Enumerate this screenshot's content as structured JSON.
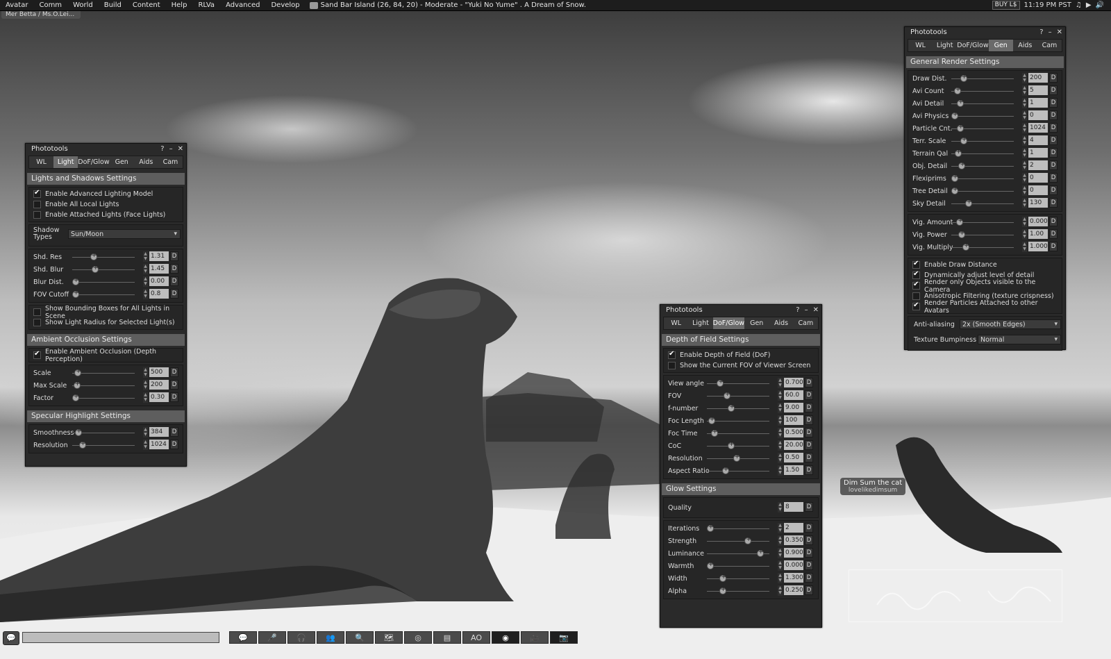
{
  "menubar": {
    "items": [
      "Avatar",
      "Comm",
      "World",
      "Build",
      "Content",
      "Help",
      "RLVa",
      "Advanced",
      "Develop"
    ],
    "location": "Sand Bar Island (26, 84, 20) - Moderate - \"Yuki No Yume\" . A Dream of Snow.",
    "buy": "BUY L$",
    "time": "11:19 PM PST",
    "nav_tag": "Mer Betta / Ms.O.Lei..."
  },
  "nametag": {
    "name": "Dim Sum the cat",
    "username": "lovelikedimsum"
  },
  "panel_light": {
    "title": "Phototools",
    "tabs": [
      "WL",
      "Light",
      "DoF/Glow",
      "Gen",
      "Aids",
      "Cam"
    ],
    "active_tab": "Light",
    "section1": "Lights and Shadows Settings",
    "checks1": [
      {
        "label": "Enable Advanced Lighting Model",
        "checked": true
      },
      {
        "label": "Enable All Local Lights",
        "checked": false
      },
      {
        "label": "Enable Attached Lights (Face Lights)",
        "checked": false
      }
    ],
    "shadow_label": "Shadow Types",
    "shadow_value": "Sun/Moon",
    "sliders1": [
      {
        "label": "Shd. Res",
        "value": "1.31",
        "pos": 0.32
      },
      {
        "label": "Shd. Blur",
        "value": "1.45",
        "pos": 0.35
      },
      {
        "label": "Blur Dist.",
        "value": "0.00",
        "pos": 0.0
      },
      {
        "label": "FOV Cutoff",
        "value": "0.8",
        "pos": 0.0
      }
    ],
    "checks2": [
      {
        "label": "Show Bounding Boxes for All Lights in Scene",
        "checked": false
      },
      {
        "label": "Show Light Radius for Selected Light(s)",
        "checked": false
      }
    ],
    "section2": "Ambient Occlusion Settings",
    "checks3": [
      {
        "label": "Enable Ambient Occlusion (Depth Perception)",
        "checked": true
      }
    ],
    "sliders2": [
      {
        "label": "Scale",
        "value": "500",
        "pos": 0.04
      },
      {
        "label": "Max Scale",
        "value": "200",
        "pos": 0.02
      },
      {
        "label": "Factor",
        "value": "0.30",
        "pos": 0.0
      }
    ],
    "section3": "Specular Highlight Settings",
    "sliders3": [
      {
        "label": "Smoothness",
        "value": "384",
        "pos": 0.05
      },
      {
        "label": "Resolution",
        "value": "1024",
        "pos": 0.12
      }
    ],
    "d": "D"
  },
  "panel_dof": {
    "title": "Phototools",
    "tabs": [
      "WL",
      "Light",
      "DoF/Glow",
      "Gen",
      "Aids",
      "Cam"
    ],
    "active_tab": "DoF/Glow",
    "section1": "Depth of Field Settings",
    "checks1": [
      {
        "label": "Enable Depth of Field (DoF)",
        "checked": true
      },
      {
        "label": "Show the Current FOV of Viewer Screen",
        "checked": false
      }
    ],
    "sliders1": [
      {
        "label": "View angle",
        "value": "0.700",
        "pos": 0.18
      },
      {
        "label": "FOV",
        "value": "60.0",
        "pos": 0.3
      },
      {
        "label": "f-number",
        "value": "9.00",
        "pos": 0.38
      },
      {
        "label": "Foc Length",
        "value": "100",
        "pos": 0.02
      },
      {
        "label": "Foc Time",
        "value": "0.500",
        "pos": 0.07
      },
      {
        "label": "CoC",
        "value": "20.00",
        "pos": 0.37
      },
      {
        "label": "Resolution",
        "value": "0.50",
        "pos": 0.47
      },
      {
        "label": "Aspect Ratio",
        "value": "1.50",
        "pos": 0.27
      }
    ],
    "section2": "Glow Settings",
    "quality_label": "Quality",
    "quality_value": "8",
    "sliders2": [
      {
        "label": "Iterations",
        "value": "2",
        "pos": 0.0
      },
      {
        "label": "Strength",
        "value": "0.350",
        "pos": 0.68
      },
      {
        "label": "Luminance",
        "value": "0.900",
        "pos": 0.9
      },
      {
        "label": "Warmth",
        "value": "0.000",
        "pos": 0.0
      },
      {
        "label": "Width",
        "value": "1.300",
        "pos": 0.23
      },
      {
        "label": "Alpha",
        "value": "0.250",
        "pos": 0.22
      }
    ],
    "d": "D"
  },
  "panel_gen": {
    "title": "Phototools",
    "tabs": [
      "WL",
      "Light",
      "DoF/Glow",
      "Gen",
      "Aids",
      "Cam"
    ],
    "active_tab": "Gen",
    "section1": "General Render Settings",
    "sliders1": [
      {
        "label": "Draw Dist.",
        "value": "200",
        "pos": 0.16
      },
      {
        "label": "Avi Count",
        "value": "5",
        "pos": 0.05
      },
      {
        "label": "Avi Detail",
        "value": "1",
        "pos": 0.1
      },
      {
        "label": "Avi Physics",
        "value": "0",
        "pos": 0.0
      },
      {
        "label": "Particle Cnt.",
        "value": "1024",
        "pos": 0.1
      },
      {
        "label": "Terr. Scale",
        "value": "4",
        "pos": 0.16
      },
      {
        "label": "Terrain Qal",
        "value": "1",
        "pos": 0.06
      },
      {
        "label": "Obj. Detail",
        "value": "2",
        "pos": 0.13
      },
      {
        "label": "Flexiprims",
        "value": "0",
        "pos": 0.0
      },
      {
        "label": "Tree Detail",
        "value": "0",
        "pos": 0.0
      },
      {
        "label": "Sky Detail",
        "value": "130",
        "pos": 0.25
      }
    ],
    "sliders2": [
      {
        "label": "Vig. Amount",
        "value": "0.000",
        "pos": 0.09
      },
      {
        "label": "Vig. Power",
        "value": "1.00",
        "pos": 0.12
      },
      {
        "label": "Vig. Multiply",
        "value": "1.000",
        "pos": 0.2
      }
    ],
    "checks1": [
      {
        "label": "Enable Draw Distance",
        "checked": true
      },
      {
        "label": "Dynamically adjust level of detail",
        "checked": true
      },
      {
        "label": "Render only Objects visible to the Camera",
        "checked": true
      },
      {
        "label": "Anisotropic Filtering (texture crispness)",
        "checked": false
      },
      {
        "label": "Render Particles Attached to other Avatars",
        "checked": true
      }
    ],
    "aa_label": "Anti-aliasing",
    "aa_value": "2x (Smooth Edges)",
    "bump_label": "Texture Bumpiness",
    "bump_value": "Normal",
    "d": "D"
  },
  "bottombar": {
    "buttons": [
      "chat-bubbles-icon",
      "microphone-icon",
      "headset-icon",
      "people-icon",
      "search-icon",
      "map-icon",
      "minimap-icon",
      "inventory-icon",
      "ao-icon",
      "phototools-icon",
      "camera-movie-icon",
      "snapshot-icon"
    ],
    "ao_label": "AO"
  }
}
